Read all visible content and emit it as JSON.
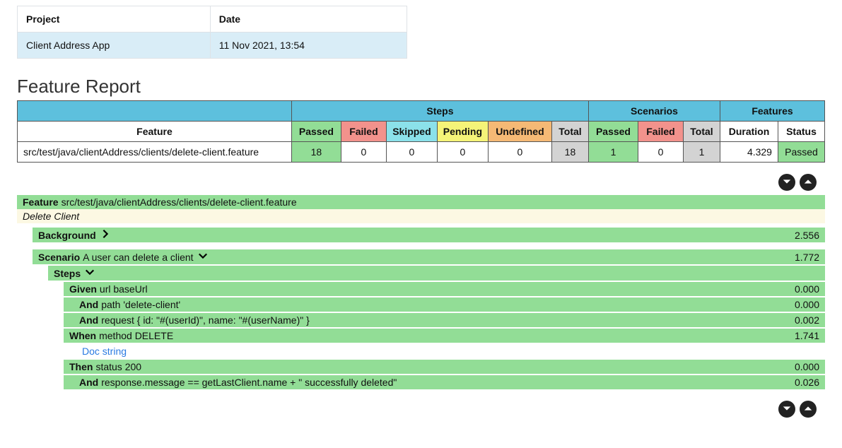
{
  "metaHeaders": {
    "project": "Project",
    "date": "Date"
  },
  "meta": {
    "project": "Client Address App",
    "date": "11 Nov 2021, 13:54"
  },
  "title": "Feature Report",
  "summary": {
    "groups": {
      "steps": "Steps",
      "scenarios": "Scenarios",
      "features": "Features"
    },
    "headers": {
      "feature": "Feature",
      "passed": "Passed",
      "failed": "Failed",
      "skipped": "Skipped",
      "pending": "Pending",
      "undefined": "Undefined",
      "total": "Total",
      "duration": "Duration",
      "status": "Status"
    },
    "row": {
      "feature": "src/test/java/clientAddress/clients/delete-client.feature",
      "stepsPassed": "18",
      "stepsFailed": "0",
      "stepsSkipped": "0",
      "stepsPending": "0",
      "stepsUndefined": "0",
      "stepsTotal": "18",
      "scnPassed": "1",
      "scnFailed": "0",
      "scnTotal": "1",
      "duration": "4.329",
      "status": "Passed"
    }
  },
  "detail": {
    "featureKw": "Feature",
    "featureName": "src/test/java/clientAddress/clients/delete-client.feature",
    "featureDesc": "Delete Client",
    "backgroundKw": "Background",
    "backgroundDur": "2.556",
    "scenarioKw": "Scenario",
    "scenarioName": "A user can delete a client",
    "scenarioDur": "1.772",
    "stepsKw": "Steps",
    "steps": [
      {
        "kw": "Given",
        "text": "url baseUrl",
        "dur": "0.000",
        "indent": false
      },
      {
        "kw": "And",
        "text": "path 'delete-client'",
        "dur": "0.000",
        "indent": true
      },
      {
        "kw": "And",
        "text": "request { id: \"#(userId)\", name: \"#(userName)\" }",
        "dur": "0.002",
        "indent": true
      },
      {
        "kw": "When",
        "text": "method DELETE",
        "dur": "1.741",
        "indent": false
      }
    ],
    "docString": "Doc string",
    "tailSteps": [
      {
        "kw": "Then",
        "text": "status 200",
        "dur": "0.000",
        "indent": false
      },
      {
        "kw": "And",
        "text": "response.message == getLastClient.name + \" successfully deleted\"",
        "dur": "0.026",
        "indent": true
      }
    ]
  },
  "chart_data": {
    "type": "table",
    "title": "Feature Report",
    "columns": [
      "Feature",
      "Steps Passed",
      "Steps Failed",
      "Steps Skipped",
      "Steps Pending",
      "Steps Undefined",
      "Steps Total",
      "Scenarios Passed",
      "Scenarios Failed",
      "Scenarios Total",
      "Duration",
      "Status"
    ],
    "rows": [
      [
        "src/test/java/clientAddress/clients/delete-client.feature",
        18,
        0,
        0,
        0,
        0,
        18,
        1,
        0,
        1,
        4.329,
        "Passed"
      ]
    ]
  }
}
